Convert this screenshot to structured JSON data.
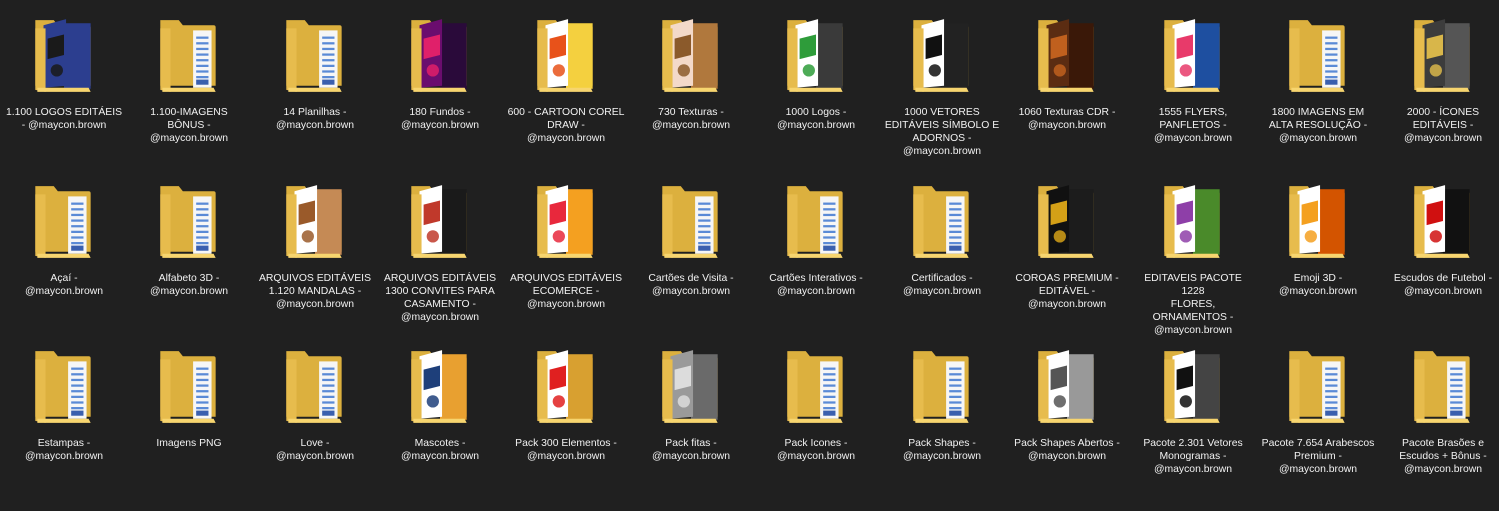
{
  "window": {
    "view": "large-icons",
    "background": "#202020"
  },
  "folders": [
    {
      "name": "1.100 LOGOS EDITÁEIS\n- @maycon.brown",
      "preview": "logo",
      "colors": [
        "#2c3e8f",
        "#1a1a1a"
      ]
    },
    {
      "name": "1.100-IMAGENS\nBÔNUS -\n@maycon.brown",
      "preview": "docs",
      "colors": []
    },
    {
      "name": "14 Planilhas -\n@maycon.brown",
      "preview": "docs",
      "colors": []
    },
    {
      "name": "180 Fundos -\n@maycon.brown",
      "preview": "image",
      "colors": [
        "#6a0d6e",
        "#e0206a",
        "#2a0a3a"
      ]
    },
    {
      "name": "600 - CARTOON COREL\nDRAW -\n@maycon.brown",
      "preview": "image",
      "colors": [
        "#ffffff",
        "#e8521a",
        "#f4d03f"
      ]
    },
    {
      "name": "730 Texturas -\n@maycon.brown",
      "preview": "image",
      "colors": [
        "#f3d9c9",
        "#8b5a2b",
        "#b0783d"
      ]
    },
    {
      "name": "1000 Logos -\n@maycon.brown",
      "preview": "image",
      "colors": [
        "#ffffff",
        "#2e9c3a",
        "#3a3a3a"
      ]
    },
    {
      "name": "1000 VETORES\nEDITÁVEIS SÍMBOLO E\nADORNOS -\n@maycon.brown",
      "preview": "image",
      "colors": [
        "#ffffff",
        "#111111",
        "#222222"
      ]
    },
    {
      "name": "1060 Texturas CDR -\n@maycon.brown",
      "preview": "image",
      "colors": [
        "#5b2c12",
        "#c0601e",
        "#3a1808"
      ]
    },
    {
      "name": "1555 FLYERS,\nPANFLETOS -\n@maycon.brown",
      "preview": "image",
      "colors": [
        "#ffffff",
        "#e83a6a",
        "#1e4fa0"
      ]
    },
    {
      "name": "1800 IMAGENS EM\nALTA RESOLUÇÃO -\n@maycon.brown",
      "preview": "docs",
      "colors": []
    },
    {
      "name": "2000 - ÍCONES\nEDITÁVEIS -\n@maycon.brown",
      "preview": "image",
      "colors": [
        "#3c3c3c",
        "#d8b64a",
        "#555555"
      ]
    },
    {
      "name": "Açaí -\n@maycon.brown",
      "preview": "docs",
      "colors": []
    },
    {
      "name": "Alfabeto 3D -\n@maycon.brown",
      "preview": "docs",
      "colors": []
    },
    {
      "name": "ARQUIVOS EDITÁVEIS\n1.120 MANDALAS -\n@maycon.brown",
      "preview": "image",
      "colors": [
        "#ffffff",
        "#9a5a2a",
        "#c58a55"
      ]
    },
    {
      "name": "ARQUIVOS EDITÁVEIS\n1300 CONVITES PARA\nCASAMENTO -\n@maycon.brown",
      "preview": "image",
      "colors": [
        "#ffffff",
        "#c0392b",
        "#1a1a1a"
      ]
    },
    {
      "name": "ARQUIVOS EDITÁVEIS\nECOMERCE -\n@maycon.brown",
      "preview": "image",
      "colors": [
        "#ffffff",
        "#e8283c",
        "#f4a020"
      ]
    },
    {
      "name": "Cartões de Visita -\n@maycon.brown",
      "preview": "docs",
      "colors": []
    },
    {
      "name": "Cartões Interativos -\n@maycon.brown",
      "preview": "docs",
      "colors": []
    },
    {
      "name": "Certificados -\n@maycon.brown",
      "preview": "docs",
      "colors": []
    },
    {
      "name": "COROAS PREMIUM -\nEDITÁVEL -\n@maycon.brown",
      "preview": "image",
      "colors": [
        "#111111",
        "#d4a017",
        "#1c1c1c"
      ]
    },
    {
      "name": "EDITAVEIS PACOTE 1228\nFLORES,\nORNAMENTOS -\n@maycon.brown",
      "preview": "image",
      "colors": [
        "#ffffff",
        "#8e3fa8",
        "#4a8a2a"
      ]
    },
    {
      "name": "Emoji 3D -\n@maycon.brown",
      "preview": "image",
      "colors": [
        "#ffffff",
        "#f4a020",
        "#d35400"
      ]
    },
    {
      "name": "Escudos de Futebol -\n@maycon.brown",
      "preview": "image",
      "colors": [
        "#ffffff",
        "#d01010",
        "#111111"
      ]
    },
    {
      "name": "Estampas -\n@maycon.brown",
      "preview": "docs",
      "colors": []
    },
    {
      "name": "Imagens PNG",
      "preview": "docs",
      "colors": []
    },
    {
      "name": "Love -\n@maycon.brown",
      "preview": "docs",
      "colors": []
    },
    {
      "name": "Mascotes -\n@maycon.brown",
      "preview": "image",
      "colors": [
        "#ffffff",
        "#1e3f7a",
        "#e8a030"
      ]
    },
    {
      "name": "Pack 300 Elementos -\n@maycon.brown",
      "preview": "image",
      "colors": [
        "#ffffff",
        "#e02020",
        "#d8a030"
      ]
    },
    {
      "name": "Pack fitas -\n@maycon.brown",
      "preview": "image",
      "colors": [
        "#9a9a9a",
        "#dcdcdc",
        "#6a6a6a"
      ]
    },
    {
      "name": "Pack Icones -\n@maycon.brown",
      "preview": "docs",
      "colors": []
    },
    {
      "name": "Pack Shapes -\n@maycon.brown",
      "preview": "docs",
      "colors": []
    },
    {
      "name": "Pack Shapes Abertos -\n@maycon.brown",
      "preview": "image",
      "colors": [
        "#ffffff",
        "#555555",
        "#999999"
      ]
    },
    {
      "name": "Pacote 2.301 Vetores\nMonogramas -\n@maycon.brown",
      "preview": "image",
      "colors": [
        "#ffffff",
        "#111111",
        "#444444"
      ]
    },
    {
      "name": "Pacote 7.654 Arabescos\nPremium -\n@maycon.brown",
      "preview": "docs",
      "colors": []
    },
    {
      "name": "Pacote Brasões e\nEscudos + Bônus -\n@maycon.brown",
      "preview": "docs",
      "colors": []
    }
  ]
}
